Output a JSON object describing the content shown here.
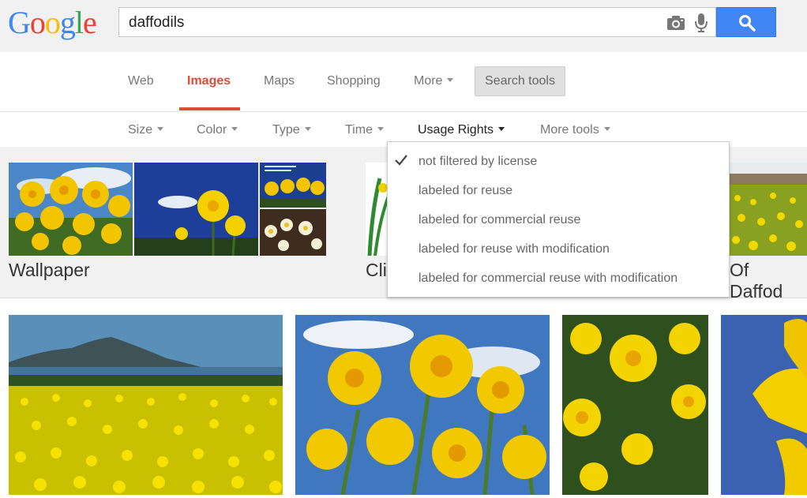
{
  "logo": {
    "text": "Google"
  },
  "search": {
    "query": "daffodils"
  },
  "tabs": [
    {
      "label": "Web"
    },
    {
      "label": "Images"
    },
    {
      "label": "Maps"
    },
    {
      "label": "Shopping"
    },
    {
      "label": "More"
    }
  ],
  "search_tools_label": "Search tools",
  "tools": [
    {
      "label": "Size"
    },
    {
      "label": "Color"
    },
    {
      "label": "Type"
    },
    {
      "label": "Time"
    },
    {
      "label": "Usage Rights"
    },
    {
      "label": "More tools"
    }
  ],
  "clusters": [
    {
      "label": "Wallpaper"
    },
    {
      "label": "Cli"
    },
    {
      "label": "Of Daffod"
    }
  ],
  "usage_rights_menu": {
    "items": [
      {
        "label": "not filtered by license"
      },
      {
        "label": "labeled for reuse"
      },
      {
        "label": "labeled for commercial reuse"
      },
      {
        "label": "labeled for reuse with modification"
      },
      {
        "label": "labeled for commercial reuse with modification"
      }
    ]
  },
  "colors": {
    "accent_red": "#dd4b39",
    "search_blue": "#4285f4",
    "band_grey": "#f1f1f1"
  },
  "icons": [
    "camera-icon",
    "mic-icon",
    "search-icon",
    "check-icon",
    "chevron-down-icon"
  ]
}
